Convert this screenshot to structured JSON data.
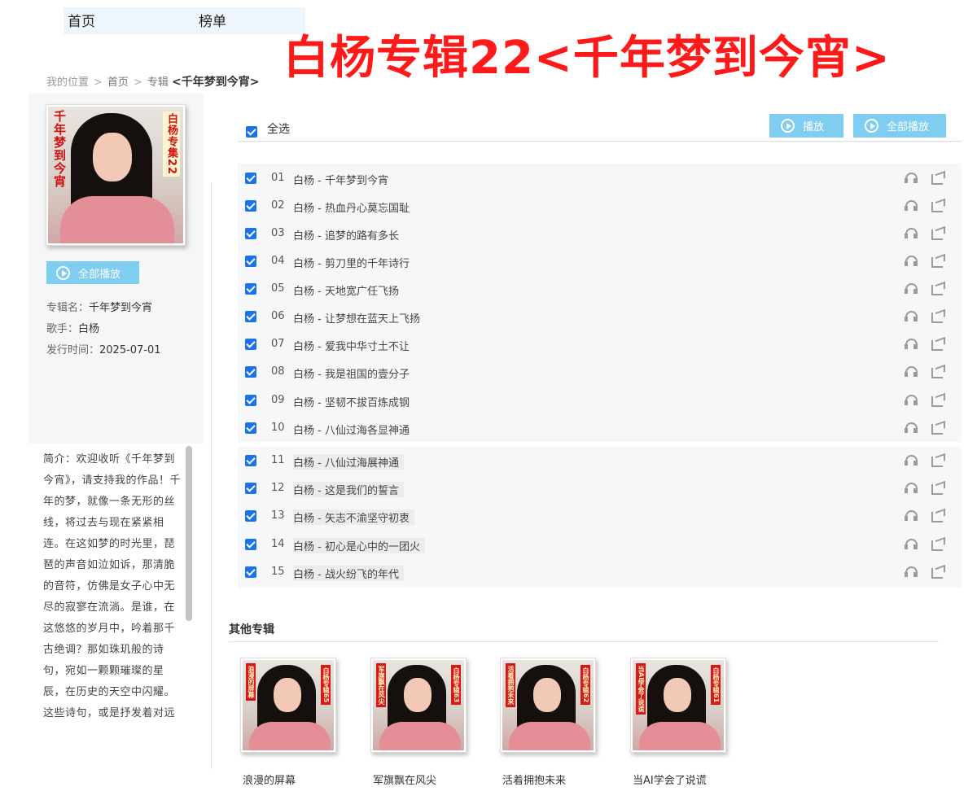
{
  "nav": {
    "home": "首页",
    "chart": "榜单"
  },
  "banner": {
    "title": "白杨专辑22<千年梦到今宵>"
  },
  "breadcrumb": {
    "label": "我的位置",
    "sep": ">",
    "home": "首页",
    "album": "专辑",
    "current": "<千年梦到今宵>"
  },
  "cover": {
    "left_text": "千年梦到今宵",
    "right_text": "白杨专集22"
  },
  "sidebar": {
    "play_all": "全部播放",
    "album_label": "专辑名：",
    "album_name": "千年梦到今宵",
    "artist_label": "歌手：",
    "artist": "白杨",
    "release_label": "发行时间：",
    "release_date": "2025-07-01",
    "intro": "简介：欢迎收听《千年梦到今宵》，请支持我的作品！千年的梦，就像一条无形的丝线，将过去与现在紧紧相连。在这如梦的时光里，琵琶的声音如泣如诉，那清脆的音符，仿佛是女子心中无尽的寂寥在流淌。是谁，在这悠悠的岁月中，吟着那千古绝调？那如珠玑般的诗句，宛如一颗颗璀璨的星辰，在历史的天空中闪耀。这些诗句，或是抒发着对远"
  },
  "list": {
    "select_all": "全选",
    "play": "播放",
    "play_all": "全部播放",
    "separator": "-",
    "tracks": [
      {
        "num": "01",
        "artist": "白杨",
        "title": "千年梦到今宵"
      },
      {
        "num": "02",
        "artist": "白杨",
        "title": "热血丹心莫忘国耻"
      },
      {
        "num": "03",
        "artist": "白杨",
        "title": "追梦的路有多长"
      },
      {
        "num": "04",
        "artist": "白杨",
        "title": "剪刀里的千年诗行"
      },
      {
        "num": "05",
        "artist": "白杨",
        "title": "天地宽广任飞扬"
      },
      {
        "num": "06",
        "artist": "白杨",
        "title": "让梦想在蓝天上飞扬"
      },
      {
        "num": "07",
        "artist": "白杨",
        "title": "爱我中华寸土不让"
      },
      {
        "num": "08",
        "artist": "白杨",
        "title": "我是祖国的壹分子"
      },
      {
        "num": "09",
        "artist": "白杨",
        "title": "坚韧不拔百炼成钢"
      },
      {
        "num": "10",
        "artist": "白杨",
        "title": "八仙过海各显神通"
      },
      {
        "num": "11",
        "artist": "白杨",
        "title": "八仙过海展神通"
      },
      {
        "num": "12",
        "artist": "白杨",
        "title": "这是我们的誓言"
      },
      {
        "num": "13",
        "artist": "白杨",
        "title": "矢志不渝坚守初衷"
      },
      {
        "num": "14",
        "artist": "白杨",
        "title": "初心是心中的一团火"
      },
      {
        "num": "15",
        "artist": "白杨",
        "title": "战火纷飞的年代"
      }
    ]
  },
  "other": {
    "title": "其他专辑",
    "albums": [
      {
        "name": "浪漫的屏幕",
        "tag_left": "浪漫的屏幕",
        "tag_right": "白杨专辑65"
      },
      {
        "name": "军旗飘在风尖",
        "tag_left": "军旗飘在风尖",
        "tag_right": "白杨专辑63"
      },
      {
        "name": "活着拥抱未来",
        "tag_left": "活着拥抱未来",
        "tag_right": "白杨专辑62"
      },
      {
        "name": "当AI学会了说谎",
        "tag_left": "当AI学会了说谎",
        "tag_right": "白杨专辑61"
      }
    ]
  },
  "colors": {
    "banner": "#ff1a1a",
    "button": "#7fcdf0",
    "checkbox": "#1a73e8"
  }
}
